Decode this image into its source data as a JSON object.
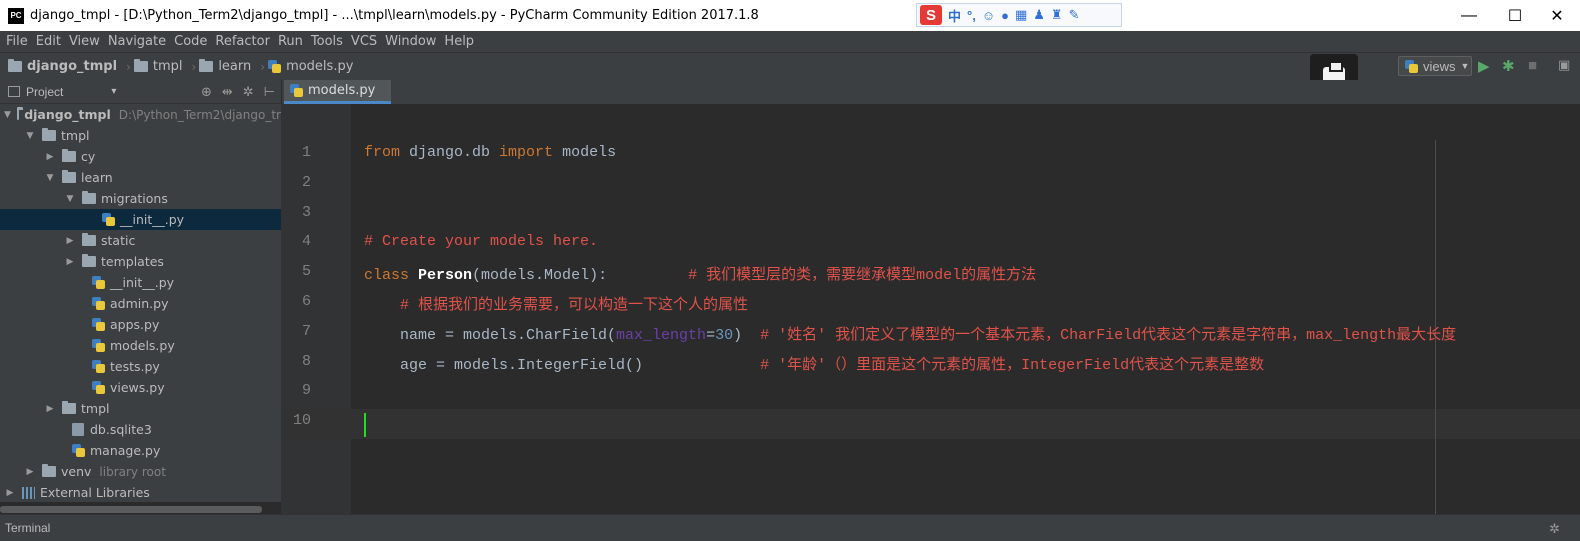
{
  "window": {
    "app_logo": "PC",
    "title": "django_tmpl - [D:\\Python_Term2\\django_tmpl] - ...\\tmpl\\learn\\models.py - PyCharm Community Edition 2017.1.8",
    "minimize": "—",
    "maximize": "☐",
    "close": "✕"
  },
  "ime_toolbar": {
    "logo": "S",
    "lang": "中",
    "punct": "°,",
    "items": [
      "emoji-icon",
      "mic-icon",
      "keyboard-icon",
      "skin-icon",
      "shirt-icon",
      "tools-icon"
    ]
  },
  "menu": [
    "File",
    "Edit",
    "View",
    "Navigate",
    "Code",
    "Refactor",
    "Run",
    "Tools",
    "VCS",
    "Window",
    "Help"
  ],
  "breadcrumbs": [
    "django_tmpl",
    "tmpl",
    "learn",
    "models.py"
  ],
  "run_config": {
    "label": "views"
  },
  "project_panel": {
    "title": "Project",
    "dropdown": "▾",
    "tools": [
      "⊕",
      "⇹",
      "✲",
      "⊢"
    ]
  },
  "tree": [
    {
      "label": "django_tmpl",
      "dim": "D:\\Python_Term2\\django_tr",
      "arrow": "▼",
      "icon": "folder",
      "indent": 0,
      "bold": true
    },
    {
      "label": "tmpl",
      "arrow": "▼",
      "icon": "folder",
      "indent": 1
    },
    {
      "label": "cy",
      "arrow": "▶",
      "icon": "folder",
      "indent": 2
    },
    {
      "label": "learn",
      "arrow": "▼",
      "icon": "folder",
      "indent": 2
    },
    {
      "label": "migrations",
      "arrow": "▼",
      "icon": "folder",
      "indent": 3
    },
    {
      "label": "__init__.py",
      "arrow": "",
      "icon": "py",
      "indent": 4,
      "selected": true
    },
    {
      "label": "static",
      "arrow": "▶",
      "icon": "folder",
      "indent": 3
    },
    {
      "label": "templates",
      "arrow": "▶",
      "icon": "folder",
      "indent": 3
    },
    {
      "label": "__init__.py",
      "arrow": "",
      "icon": "py",
      "indent": 3.5
    },
    {
      "label": "admin.py",
      "arrow": "",
      "icon": "py",
      "indent": 3.5
    },
    {
      "label": "apps.py",
      "arrow": "",
      "icon": "py",
      "indent": 3.5
    },
    {
      "label": "models.py",
      "arrow": "",
      "icon": "py",
      "indent": 3.5
    },
    {
      "label": "tests.py",
      "arrow": "",
      "icon": "py",
      "indent": 3.5
    },
    {
      "label": "views.py",
      "arrow": "",
      "icon": "py",
      "indent": 3.5
    },
    {
      "label": "tmpl",
      "arrow": "▶",
      "icon": "folder",
      "indent": 2
    },
    {
      "label": "db.sqlite3",
      "arrow": "",
      "icon": "db",
      "indent": 2.5
    },
    {
      "label": "manage.py",
      "arrow": "",
      "icon": "py",
      "indent": 2.5
    },
    {
      "label": "venv",
      "dim": "library root",
      "arrow": "▶",
      "icon": "folder",
      "indent": 1
    },
    {
      "label": "External Libraries",
      "arrow": "▶",
      "icon": "bars",
      "indent": 0
    }
  ],
  "editor": {
    "tab": "models.py",
    "line_numbers": [
      "1",
      "2",
      "3",
      "4",
      "5",
      "6",
      "7",
      "8",
      "9",
      "10"
    ],
    "lines": [
      [
        {
          "t": "from",
          "c": "kw"
        },
        {
          "t": " django.db ",
          "c": ""
        },
        {
          "t": "import",
          "c": "kw"
        },
        {
          "t": " models",
          "c": ""
        }
      ],
      [],
      [],
      [
        {
          "t": "# Create your models here.",
          "c": "cm"
        }
      ],
      [
        {
          "t": "class",
          "c": "kw"
        },
        {
          "t": " ",
          "c": ""
        },
        {
          "t": "Person",
          "c": "cls"
        },
        {
          "t": "(models.Model):         ",
          "c": ""
        },
        {
          "t": "# 我们模型层的类，需要继承模型model的属性方法",
          "c": "cm"
        }
      ],
      [
        {
          "t": "    ",
          "c": ""
        },
        {
          "t": "# 根据我们的业务需要，可以构造一下这个人的属性",
          "c": "cm"
        }
      ],
      [
        {
          "t": "    name = models.CharField(",
          "c": ""
        },
        {
          "t": "max_length",
          "c": "prm"
        },
        {
          "t": "=",
          "c": ""
        },
        {
          "t": "30",
          "c": "num"
        },
        {
          "t": ")  ",
          "c": ""
        },
        {
          "t": "# '姓名' 我们定义了模型的一个基本元素，CharField代表这个元素是字符串，max_length最大长度",
          "c": "cm"
        }
      ],
      [
        {
          "t": "    age = models.IntegerField()             ",
          "c": ""
        },
        {
          "t": "# '年龄'（）里面是这个元素的属性，IntegerField代表这个元素是整数",
          "c": "cm"
        }
      ],
      [],
      []
    ]
  },
  "statusbar": {
    "left": "Terminal",
    "gear": "✲"
  }
}
